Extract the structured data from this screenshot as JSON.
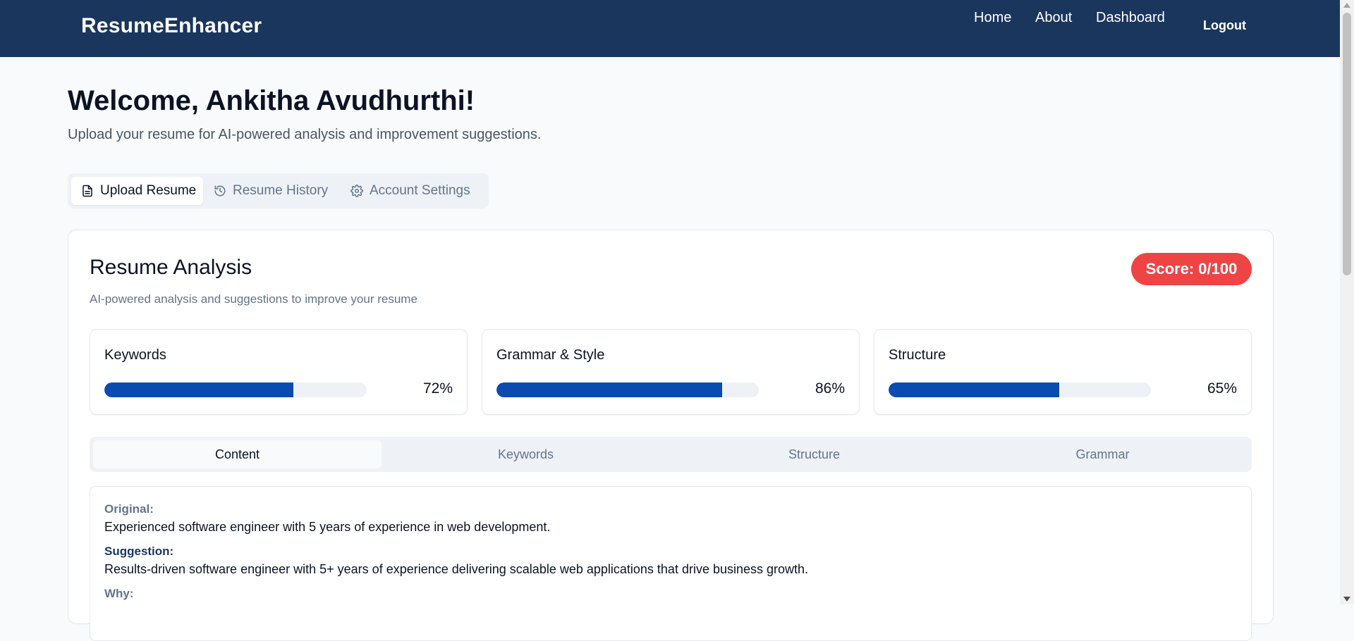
{
  "nav": {
    "brand": "ResumeEnhancer",
    "links": [
      "Home",
      "About",
      "Dashboard"
    ],
    "logout": "Logout"
  },
  "welcome": {
    "title": "Welcome, Ankitha Avudhurthi!",
    "subtitle": "Upload your resume for AI-powered analysis and improvement suggestions."
  },
  "tabs": [
    {
      "label": "Upload Resume",
      "icon": "document-icon",
      "active": true
    },
    {
      "label": "Resume History",
      "icon": "history-icon",
      "active": false
    },
    {
      "label": "Account Settings",
      "icon": "gear-icon",
      "active": false
    }
  ],
  "analysis": {
    "title": "Resume Analysis",
    "subtitle": "AI-powered analysis and suggestions to improve your resume",
    "score": "Score: 0/100",
    "score_color": "#ef4444",
    "metrics": [
      {
        "label": "Keywords",
        "value": "72%",
        "percent": 72
      },
      {
        "label": "Grammar & Style",
        "value": "86%",
        "percent": 86
      },
      {
        "label": "Structure",
        "value": "65%",
        "percent": 65
      }
    ],
    "accent_color": "#0a4bb0",
    "subtabs": [
      "Content",
      "Keywords",
      "Structure",
      "Grammar"
    ],
    "active_subtab": "Content",
    "suggestion": {
      "original_label": "Original:",
      "original_text": "Experienced software engineer with 5 years of experience in web development.",
      "suggestion_label": "Suggestion:",
      "suggestion_text": "Results-driven software engineer with 5+ years of experience delivering scalable web applications that drive business growth.",
      "why_label": "Why:"
    }
  },
  "colors": {
    "navbar": "#1b365d",
    "background": "#f8fafc"
  }
}
